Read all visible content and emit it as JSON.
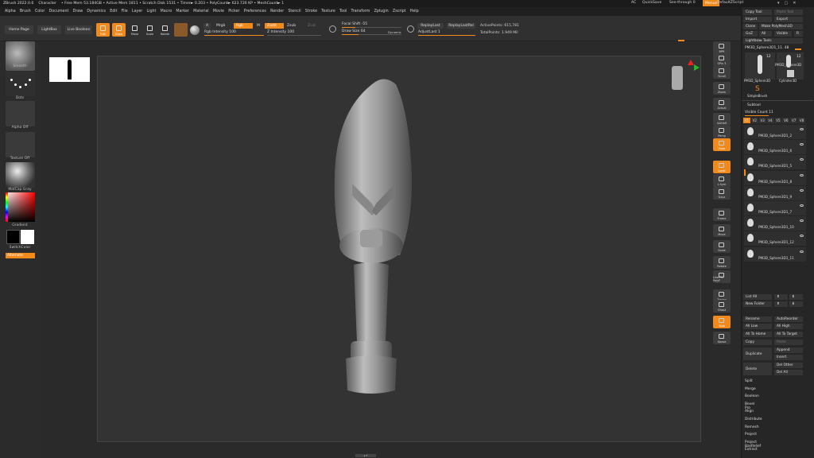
{
  "titlebar": {
    "app": "ZBrush 2022.0.6",
    "project": "Character",
    "stats": "• Free Mem 53.184GB • Active Mem 1811 • Scratch Disk 1531 • Timer► 0.203 • PolyCount► 623.726 KP • MeshCount► 1",
    "ac": "AC",
    "quicksave": "QuickSave",
    "seethrough": "See-through 0",
    "menus": "Menus",
    "default": "DefaultZScript"
  },
  "menubar": [
    "Alpha",
    "Brush",
    "Color",
    "Document",
    "Draw",
    "Dynamics",
    "Edit",
    "File",
    "Layer",
    "Light",
    "Macro",
    "Marker",
    "Material",
    "Movie",
    "Picker",
    "Preferences",
    "Render",
    "Stencil",
    "Stroke",
    "Texture",
    "Tool",
    "Transform",
    "Zplugin",
    "Zscript",
    "Help"
  ],
  "shelf": {
    "home": "Home Page",
    "lightbox": "LightBox",
    "livebool": "Live Boolean",
    "tools": [
      "Edit",
      "Draw",
      "Move",
      "Scale",
      "Rotate"
    ],
    "a": "A",
    "mrgb": "Mrgb",
    "rgb": "Rgb",
    "m": "M",
    "zadd": "Zadd",
    "zsub": "Zsub",
    "zcut": "Zcut",
    "rgb_intensity": "Rgb Intensity 100",
    "z_intensity": "Z Intensity 100",
    "focal": "Focal Shift -55",
    "drawsize": "Draw Size 64",
    "dynamic": "Dynamic",
    "replaylast": "ReplayLast",
    "replaylastrel": "ReplayLastRel",
    "adjustlast": "AdjustLast 1",
    "activepoints": "ActivePoints: 615,781",
    "totalpoints": "TotalPoints: 1.949 Mil"
  },
  "left": {
    "brush": "Smooth",
    "stroke": "Dots",
    "alpha": "Alpha Off",
    "texture": "Texture Off",
    "material": "MatCap Gray",
    "gradient": "Gradient",
    "switch": "SwitchColor",
    "alternate": "Alternate"
  },
  "righttools": [
    "BPR",
    "SPix 3",
    "Scroll",
    "Zoom",
    "Actual",
    "AAHalf",
    "Persp",
    "Floor",
    "Local",
    "L.Sym",
    "Gxyz",
    "Frame",
    "Move",
    "Scale",
    "Rotate",
    "Line Fill PolyF",
    "Transp",
    "Ghost",
    "Solo",
    "Xpose"
  ],
  "rpanel": {
    "copytool": "Copy Tool",
    "pastetool": "Paste Tool",
    "import": "Import",
    "export": "Export",
    "clone": "Clone",
    "makepoly": "Make PolyMesh3D",
    "goz": "GoZ",
    "all": "All",
    "visible": "Visible",
    "r": "R",
    "lightboxtools": "Lightbox▸ Tools",
    "current": "PM3D_Sphere3D1_11. 48",
    "n12a": "12",
    "n12b": "12",
    "th1": "PM3D_Sphere3D",
    "th2": "Cylinder3D",
    "th3": "PM3D_Sphere3D",
    "th4": "SimpleBrush",
    "subtool": "Subtool",
    "visiblecount": "Visible Count 11",
    "vtabs": [
      "V1",
      "V2",
      "V3",
      "V4",
      "V5",
      "V6",
      "V7",
      "V8"
    ],
    "subtools": [
      "PM3D_Sphere3D1_2",
      "PM3D_Sphere3D1_6",
      "PM3D_Sphere3D1_5",
      "PM3D_Sphere3D1_8",
      "PM3D_Sphere3D1_9",
      "PM3D_Sphere3D1_7",
      "PM3D_Sphere3D1_10",
      "PM3D_Sphere3D1_12",
      "PM3D_Sphere3D1_11"
    ],
    "listall": "List All",
    "newfolder": "New Folder",
    "rename": "Rename",
    "autoreorder": "AutoReorder",
    "alllow": "All Low",
    "allhigh": "All High",
    "alltohome": "All To Home",
    "alltotarget": "All To Target",
    "copy": "Copy",
    "paste": "Paste",
    "append": "Append",
    "duplicate": "Duplicate",
    "insert": "Insert",
    "delete": "Delete",
    "delother": "Del Other",
    "delall": "Del All",
    "sections": [
      "Split",
      "Merge",
      "Boolean",
      "Bevel Pro",
      "Align",
      "Distribute",
      "Remesh",
      "Project",
      "Project BasRelief",
      "Extract"
    ]
  }
}
